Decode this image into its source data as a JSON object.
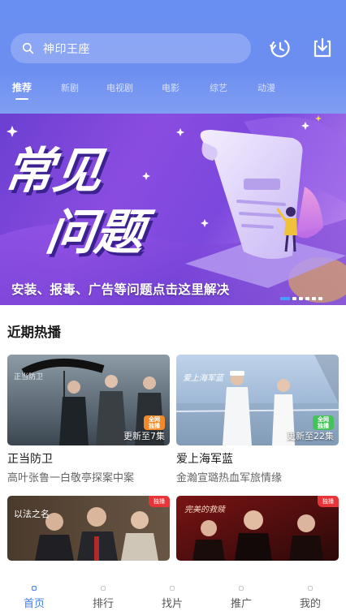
{
  "search": {
    "placeholder_text": "神印王座"
  },
  "header_icons": [
    "history-clock-icon",
    "download-icon"
  ],
  "tabs": [
    {
      "label": "推荐",
      "active": true
    },
    {
      "label": "新剧",
      "active": false
    },
    {
      "label": "电视剧",
      "active": false
    },
    {
      "label": "电影",
      "active": false
    },
    {
      "label": "综艺",
      "active": false
    },
    {
      "label": "动漫",
      "active": false
    }
  ],
  "banner": {
    "title_line1": "常见",
    "title_line2": "问题",
    "caption": "安装、报毒、广告等问题点击这里解决",
    "slide_count": 6,
    "active_slide": 1
  },
  "section": {
    "title": "近期热播"
  },
  "cards": [
    {
      "title": "正当防卫",
      "desc": "高叶张鲁一白敬亭探案中案",
      "episode": "更新至7集",
      "badge": "全网\n独播",
      "poster_text": "正当防卫"
    },
    {
      "title": "爱上海军蓝",
      "desc": "金瀚宣璐热血军旅情缘",
      "episode": "更新至22集",
      "badge": "全网\n独播",
      "poster_text": "爱上海军蓝"
    },
    {
      "title": "",
      "desc": "",
      "episode": "",
      "corner": "独播",
      "poster_text": "以法之名"
    },
    {
      "title": "",
      "desc": "",
      "episode": "",
      "corner": "独播",
      "poster_text": "完美的救赎"
    }
  ],
  "bottom_nav": [
    {
      "label": "首页",
      "active": true
    },
    {
      "label": "排行",
      "active": false
    },
    {
      "label": "找片",
      "active": false
    },
    {
      "label": "推广",
      "active": false
    },
    {
      "label": "我的",
      "active": false
    }
  ],
  "colors": {
    "header": "#6a8ff2",
    "accent": "#3d7df0",
    "banner": "#7b48de",
    "badge_green": "#46c25a",
    "badge_orange": "#f08a2a",
    "corner_red": "#e8353a"
  }
}
